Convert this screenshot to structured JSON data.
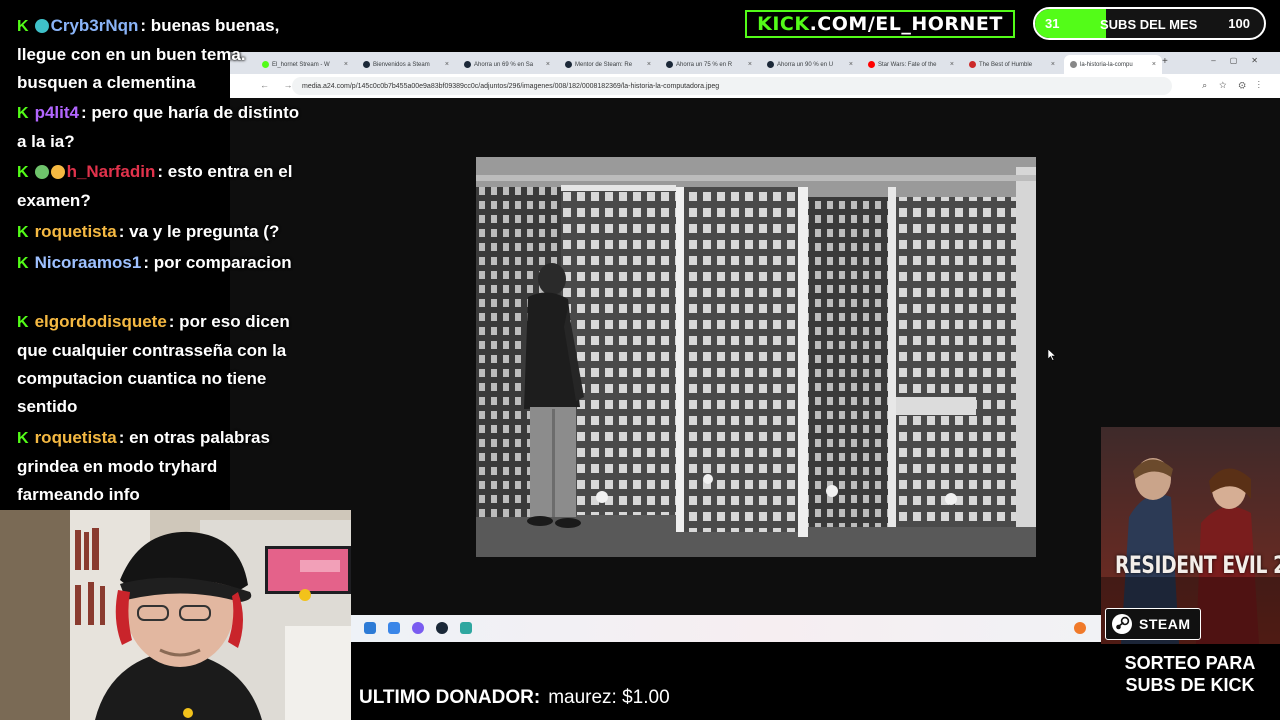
{
  "stream": {
    "brand": {
      "k": "KICK",
      "rest": ".COM/EL_HORNET"
    },
    "subs_goal": {
      "current": "31",
      "label": "SUBS DEL MES",
      "goal": "100",
      "progress_fraction": 0.31
    },
    "last_donor": {
      "label": "ULTIMO DONADOR:",
      "value": "maurez: $1.00"
    },
    "giveaway": {
      "game_title": "RESIDENT EVIL 2",
      "platform": "STEAM",
      "line1": "SORTEO PARA",
      "line2": "SUBS DE KICK"
    }
  },
  "chat": {
    "messages": [
      {
        "user": "Cryb3rNqn",
        "user_color": "#8ab4f8",
        "text": ": buenas buenas, llegue con en un buen tema. busquen a clementina"
      },
      {
        "user": "p4lit4",
        "user_color": "#b266ff",
        "text": ": pero que haría de distinto a la ia?"
      },
      {
        "user": "h_Narfadin",
        "user_color": "#e0324b",
        "text": ": esto entra en el examen?"
      },
      {
        "user": "roquetista",
        "user_color": "#f5b942",
        "text": ": va y le pregunta (?"
      },
      {
        "user": "Nicoraamos1",
        "user_color": "#9ec1ff",
        "text": ": por comparacion"
      },
      {
        "user": "elgordodisquete",
        "user_color": "#f5b942",
        "text": ": por eso dicen que cualquier contrasseña con la computacion cuantica no tiene sentido"
      },
      {
        "user": "roquetista",
        "user_color": "#f5b942",
        "text": ": en otras palabras grindea en modo tryhard farmeando info"
      }
    ]
  },
  "browser": {
    "tabs": [
      {
        "label": "El_hornet Stream - W",
        "icon": "kick-icon",
        "color": "#53fc18"
      },
      {
        "label": "Bienvenidos a Steam",
        "icon": "steam-icon",
        "color": "#1b2838"
      },
      {
        "label": "Ahorra un 69 % en Sa",
        "icon": "steam-icon",
        "color": "#1b2838"
      },
      {
        "label": "Mentor de Steam: Re",
        "icon": "steam-icon",
        "color": "#1b2838"
      },
      {
        "label": "Ahorra un 75 % en R",
        "icon": "steam-icon",
        "color": "#1b2838"
      },
      {
        "label": "Ahorra un 90 % en U",
        "icon": "steam-icon",
        "color": "#1b2838"
      },
      {
        "label": "Star Wars: Fate of the",
        "icon": "youtube-icon",
        "color": "#ff0000"
      },
      {
        "label": "The Best of Humble",
        "icon": "humble-icon",
        "color": "#cc2929"
      },
      {
        "label": "la-historia-la-compu",
        "icon": "image-icon",
        "color": "#888888"
      }
    ],
    "url": "media.a24.com/p/145c0c0b7b455a00e9a83bf09389cc0c/adjuntos/296/imagenes/008/182/0008182369/la-historia-la-computadora.jpeg"
  }
}
